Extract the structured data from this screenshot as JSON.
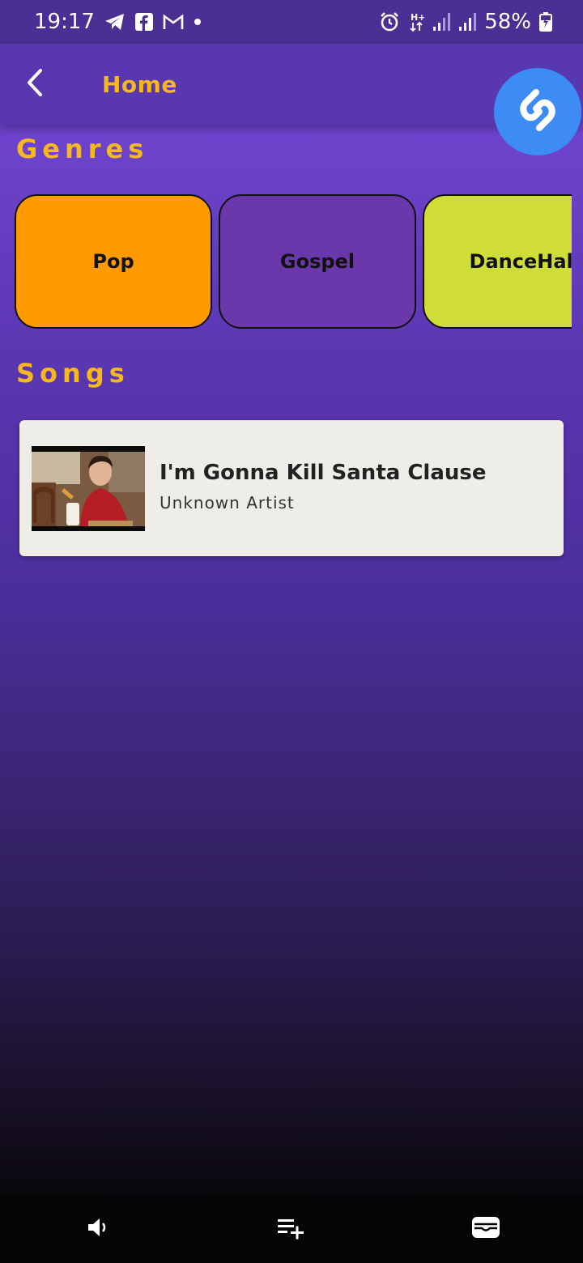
{
  "status_bar": {
    "time": "19:17",
    "battery": "58%",
    "icons_left": [
      "telegram-icon",
      "facebook-icon",
      "gmail-icon",
      "dot-icon"
    ],
    "icons_right": [
      "alarm-icon",
      "data-arrows-icon",
      "signal-icon",
      "signal-icon",
      "battery-icon"
    ]
  },
  "app_bar": {
    "back_icon": "back-arrow-icon",
    "title": "Home"
  },
  "shazam": {
    "icon": "shazam-icon",
    "color": "#3d8bf5"
  },
  "genres": {
    "title": "Genres",
    "items": [
      {
        "label": "Pop",
        "color": "#ff9a00"
      },
      {
        "label": "Gospel",
        "color": "#6a38aa"
      },
      {
        "label": "DanceHall",
        "color": "#d0dd38"
      }
    ]
  },
  "songs": {
    "title": "Songs",
    "items": [
      {
        "title": "I'm Gonna Kill Santa Clause",
        "artist": "Unknown Artist",
        "thumbnail": "video-thumbnail"
      }
    ]
  },
  "bottom_nav": {
    "items": [
      {
        "icon": "volume-icon"
      },
      {
        "icon": "playlist-add-icon"
      },
      {
        "icon": "wallet-icon"
      }
    ]
  },
  "colors": {
    "accent": "#f6b81c",
    "status_bar": "#4b2f95",
    "app_bar": "#5837b0",
    "card_bg": "#eeede8"
  }
}
